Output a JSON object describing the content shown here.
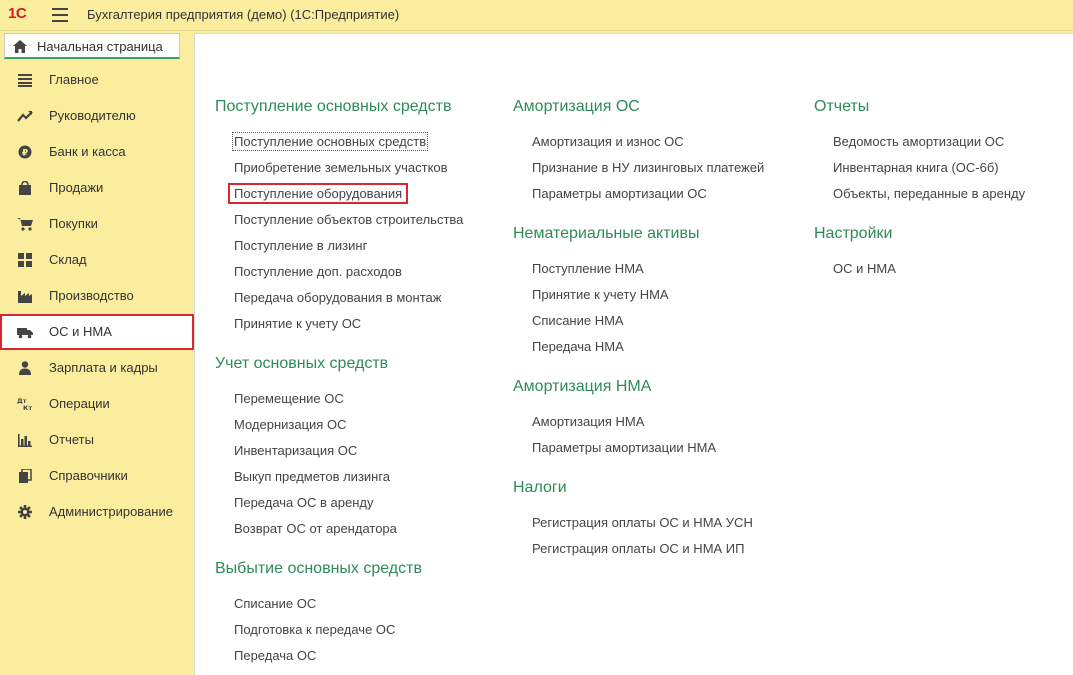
{
  "app": {
    "logo": "1С",
    "title": "Бухгалтерия предприятия (демо)  (1С:Предприятие)"
  },
  "home_tab": {
    "label": "Начальная страница"
  },
  "sidebar": {
    "items": [
      {
        "label": "Главное",
        "icon": "list-icon"
      },
      {
        "label": "Руководителю",
        "icon": "trend-icon"
      },
      {
        "label": "Банк и касса",
        "icon": "ruble-coin-icon"
      },
      {
        "label": "Продажи",
        "icon": "bag-icon"
      },
      {
        "label": "Покупки",
        "icon": "cart-icon"
      },
      {
        "label": "Склад",
        "icon": "grid-icon"
      },
      {
        "label": "Производство",
        "icon": "factory-icon"
      },
      {
        "label": "ОС и НМА",
        "icon": "truck-icon",
        "active": true
      },
      {
        "label": "Зарплата и кадры",
        "icon": "person-icon"
      },
      {
        "label": "Операции",
        "icon": "dt-kt-icon"
      },
      {
        "label": "Отчеты",
        "icon": "bar-chart-icon"
      },
      {
        "label": "Справочники",
        "icon": "books-icon"
      },
      {
        "label": "Администрирование",
        "icon": "gear-icon"
      }
    ],
    "dtkt_text": {
      "dt": "Дт",
      "kt": "Кт"
    }
  },
  "main": {
    "col1": {
      "group1": {
        "title": "Поступление основных средств",
        "links": [
          "Поступление основных средств",
          "Приобретение земельных участков",
          "Поступление оборудования",
          "Поступление объектов строительства",
          "Поступление в лизинг",
          "Поступление доп. расходов",
          "Передача оборудования в монтаж",
          "Принятие к учету ОС"
        ]
      },
      "group2": {
        "title": "Учет основных средств",
        "links": [
          "Перемещение ОС",
          "Модернизация ОС",
          "Инвентаризация ОС",
          "Выкуп предметов лизинга",
          "Передача ОС в аренду",
          "Возврат ОС от арендатора"
        ]
      },
      "group3": {
        "title": "Выбытие основных средств",
        "links": [
          "Списание ОС",
          "Подготовка к передаче ОС",
          "Передача ОС"
        ]
      }
    },
    "col2": {
      "group1": {
        "title": "Амортизация ОС",
        "links": [
          "Амортизация и износ ОС",
          "Признание в НУ лизинговых платежей",
          "Параметры амортизации ОС"
        ]
      },
      "group2": {
        "title": "Нематериальные активы",
        "links": [
          "Поступление НМА",
          "Принятие к учету НМА",
          "Списание НМА",
          "Передача НМА"
        ]
      },
      "group3": {
        "title": "Амортизация НМА",
        "links": [
          "Амортизация НМА",
          "Параметры амортизации НМА"
        ]
      },
      "group4": {
        "title": "Налоги",
        "links": [
          "Регистрация оплаты ОС и НМА УСН",
          "Регистрация оплаты ОС и НМА ИП"
        ]
      }
    },
    "col3": {
      "group1": {
        "title": "Отчеты",
        "links": [
          "Ведомость амортизации ОС",
          "Инвентарная книга (ОС-6б)",
          "Объекты, переданные в аренду"
        ]
      },
      "group2": {
        "title": "Настройки",
        "links": [
          "ОС и НМА"
        ]
      }
    }
  },
  "colors": {
    "accent_green": "#2e8b57",
    "sidebar_bg": "#fbed9e",
    "highlight_red": "#d7282f"
  }
}
